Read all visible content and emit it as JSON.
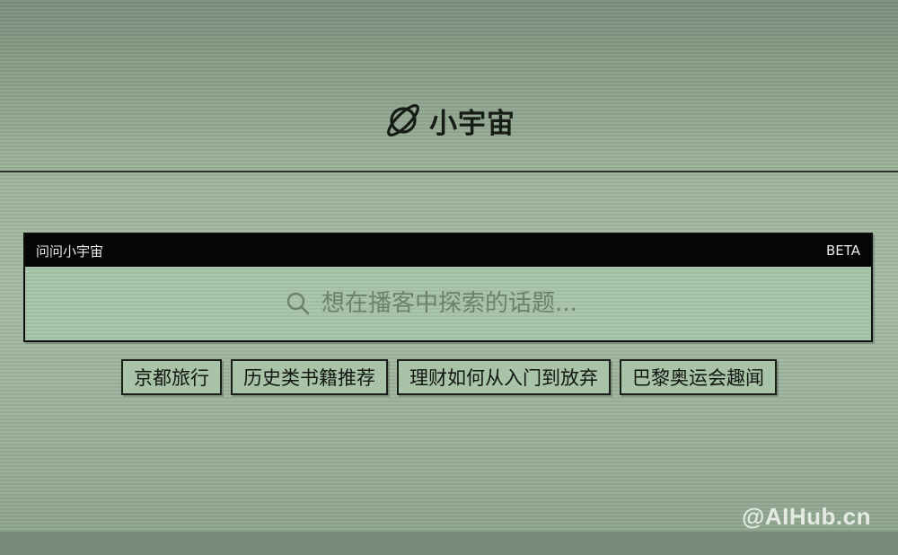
{
  "logo": {
    "text": "小宇宙",
    "icon": "planet-icon"
  },
  "ask_panel": {
    "title": "问问小宇宙",
    "badge": "BETA",
    "search_placeholder": "想在播客中探索的话题...",
    "search_icon": "search-icon"
  },
  "suggestions": [
    {
      "label": "京都旅行"
    },
    {
      "label": "历史类书籍推荐"
    },
    {
      "label": "理财如何从入门到放弃"
    },
    {
      "label": "巴黎奥运会趣闻"
    }
  ],
  "watermark": "@AIHub.cn",
  "colors": {
    "background": "#97ad96",
    "panel": "#a7c4a7",
    "header": "#050505",
    "text": "#111611"
  }
}
